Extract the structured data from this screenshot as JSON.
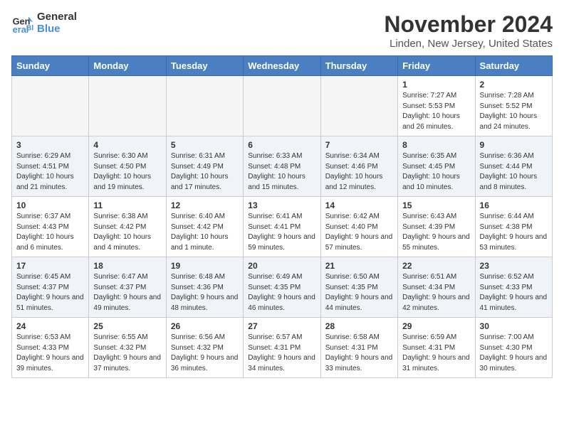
{
  "logo": {
    "text_general": "General",
    "text_blue": "Blue"
  },
  "title": "November 2024",
  "location": "Linden, New Jersey, United States",
  "headers": [
    "Sunday",
    "Monday",
    "Tuesday",
    "Wednesday",
    "Thursday",
    "Friday",
    "Saturday"
  ],
  "weeks": [
    {
      "row": 1,
      "days": [
        {
          "date": "",
          "info": ""
        },
        {
          "date": "",
          "info": ""
        },
        {
          "date": "",
          "info": ""
        },
        {
          "date": "",
          "info": ""
        },
        {
          "date": "",
          "info": ""
        },
        {
          "date": "1",
          "info": "Sunrise: 7:27 AM\nSunset: 5:53 PM\nDaylight: 10 hours and 26 minutes."
        },
        {
          "date": "2",
          "info": "Sunrise: 7:28 AM\nSunset: 5:52 PM\nDaylight: 10 hours and 24 minutes."
        }
      ]
    },
    {
      "row": 2,
      "days": [
        {
          "date": "3",
          "info": "Sunrise: 6:29 AM\nSunset: 4:51 PM\nDaylight: 10 hours and 21 minutes."
        },
        {
          "date": "4",
          "info": "Sunrise: 6:30 AM\nSunset: 4:50 PM\nDaylight: 10 hours and 19 minutes."
        },
        {
          "date": "5",
          "info": "Sunrise: 6:31 AM\nSunset: 4:49 PM\nDaylight: 10 hours and 17 minutes."
        },
        {
          "date": "6",
          "info": "Sunrise: 6:33 AM\nSunset: 4:48 PM\nDaylight: 10 hours and 15 minutes."
        },
        {
          "date": "7",
          "info": "Sunrise: 6:34 AM\nSunset: 4:46 PM\nDaylight: 10 hours and 12 minutes."
        },
        {
          "date": "8",
          "info": "Sunrise: 6:35 AM\nSunset: 4:45 PM\nDaylight: 10 hours and 10 minutes."
        },
        {
          "date": "9",
          "info": "Sunrise: 6:36 AM\nSunset: 4:44 PM\nDaylight: 10 hours and 8 minutes."
        }
      ]
    },
    {
      "row": 3,
      "days": [
        {
          "date": "10",
          "info": "Sunrise: 6:37 AM\nSunset: 4:43 PM\nDaylight: 10 hours and 6 minutes."
        },
        {
          "date": "11",
          "info": "Sunrise: 6:38 AM\nSunset: 4:42 PM\nDaylight: 10 hours and 4 minutes."
        },
        {
          "date": "12",
          "info": "Sunrise: 6:40 AM\nSunset: 4:42 PM\nDaylight: 10 hours and 1 minute."
        },
        {
          "date": "13",
          "info": "Sunrise: 6:41 AM\nSunset: 4:41 PM\nDaylight: 9 hours and 59 minutes."
        },
        {
          "date": "14",
          "info": "Sunrise: 6:42 AM\nSunset: 4:40 PM\nDaylight: 9 hours and 57 minutes."
        },
        {
          "date": "15",
          "info": "Sunrise: 6:43 AM\nSunset: 4:39 PM\nDaylight: 9 hours and 55 minutes."
        },
        {
          "date": "16",
          "info": "Sunrise: 6:44 AM\nSunset: 4:38 PM\nDaylight: 9 hours and 53 minutes."
        }
      ]
    },
    {
      "row": 4,
      "days": [
        {
          "date": "17",
          "info": "Sunrise: 6:45 AM\nSunset: 4:37 PM\nDaylight: 9 hours and 51 minutes."
        },
        {
          "date": "18",
          "info": "Sunrise: 6:47 AM\nSunset: 4:37 PM\nDaylight: 9 hours and 49 minutes."
        },
        {
          "date": "19",
          "info": "Sunrise: 6:48 AM\nSunset: 4:36 PM\nDaylight: 9 hours and 48 minutes."
        },
        {
          "date": "20",
          "info": "Sunrise: 6:49 AM\nSunset: 4:35 PM\nDaylight: 9 hours and 46 minutes."
        },
        {
          "date": "21",
          "info": "Sunrise: 6:50 AM\nSunset: 4:35 PM\nDaylight: 9 hours and 44 minutes."
        },
        {
          "date": "22",
          "info": "Sunrise: 6:51 AM\nSunset: 4:34 PM\nDaylight: 9 hours and 42 minutes."
        },
        {
          "date": "23",
          "info": "Sunrise: 6:52 AM\nSunset: 4:33 PM\nDaylight: 9 hours and 41 minutes."
        }
      ]
    },
    {
      "row": 5,
      "days": [
        {
          "date": "24",
          "info": "Sunrise: 6:53 AM\nSunset: 4:33 PM\nDaylight: 9 hours and 39 minutes."
        },
        {
          "date": "25",
          "info": "Sunrise: 6:55 AM\nSunset: 4:32 PM\nDaylight: 9 hours and 37 minutes."
        },
        {
          "date": "26",
          "info": "Sunrise: 6:56 AM\nSunset: 4:32 PM\nDaylight: 9 hours and 36 minutes."
        },
        {
          "date": "27",
          "info": "Sunrise: 6:57 AM\nSunset: 4:31 PM\nDaylight: 9 hours and 34 minutes."
        },
        {
          "date": "28",
          "info": "Sunrise: 6:58 AM\nSunset: 4:31 PM\nDaylight: 9 hours and 33 minutes."
        },
        {
          "date": "29",
          "info": "Sunrise: 6:59 AM\nSunset: 4:31 PM\nDaylight: 9 hours and 31 minutes."
        },
        {
          "date": "30",
          "info": "Sunrise: 7:00 AM\nSunset: 4:30 PM\nDaylight: 9 hours and 30 minutes."
        }
      ]
    }
  ]
}
